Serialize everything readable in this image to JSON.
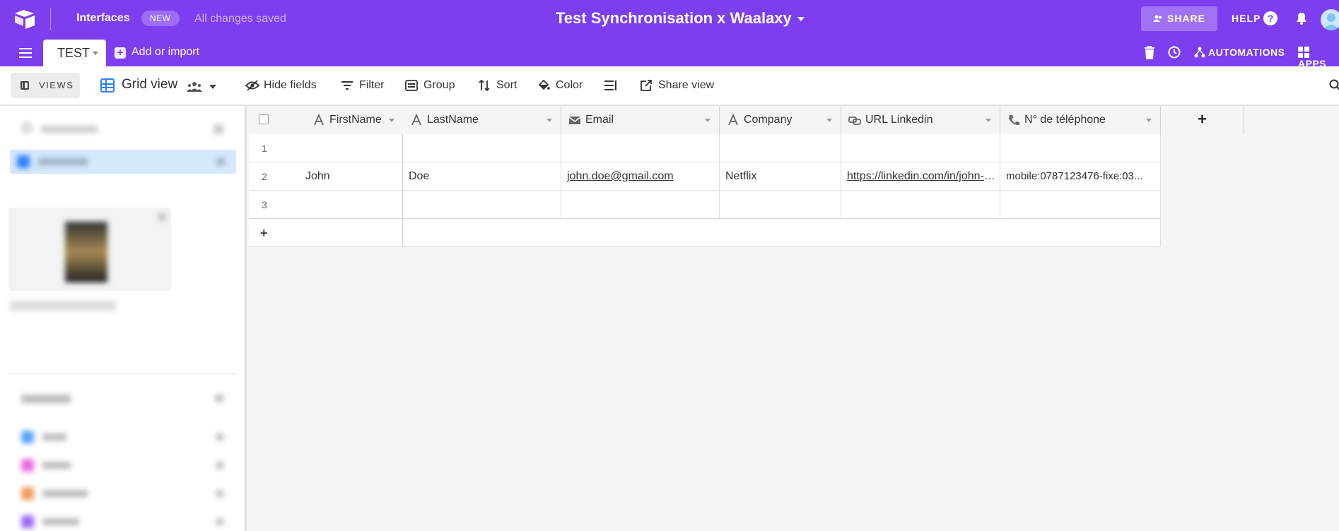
{
  "topbar": {
    "interfaces": "Interfaces",
    "new_badge": "NEW",
    "save_status": "All changes saved",
    "base_title": "Test Synchronisation x Waalaxy",
    "share": "SHARE",
    "help": "HELP",
    "help_icon": "?"
  },
  "tabsbar": {
    "active_table": "TEST",
    "add_or_import": "Add or import",
    "automations": "AUTOMATIONS",
    "apps": "APPS"
  },
  "toolbar": {
    "views": "VIEWS",
    "view_name": "Grid view",
    "hide_fields": "Hide fields",
    "filter": "Filter",
    "group": "Group",
    "sort": "Sort",
    "color": "Color",
    "share_view": "Share view"
  },
  "grid": {
    "columns": [
      "FirstName",
      "LastName",
      "Email",
      "Company",
      "URL Linkedin",
      "N° de téléphone"
    ],
    "column_icons": [
      "text-icon",
      "text-icon",
      "email-icon",
      "text-icon",
      "link-icon",
      "phone-icon"
    ],
    "rows": [
      {
        "num": "1",
        "cells": [
          "",
          "",
          "",
          "",
          "",
          ""
        ]
      },
      {
        "num": "2",
        "cells": [
          "John",
          "Doe",
          "john.doe@gmail.com",
          "Netflix",
          "https://linkedin.com/in/john-doe",
          "mobile:0787123476-fixe:03..."
        ]
      },
      {
        "num": "3",
        "cells": [
          "",
          "",
          "",
          "",
          "",
          ""
        ]
      }
    ],
    "add_column": "+",
    "add_row": "+"
  },
  "colors": {
    "brand_purple": "#7d3ef0",
    "view_blue": "#2d7ff9"
  }
}
